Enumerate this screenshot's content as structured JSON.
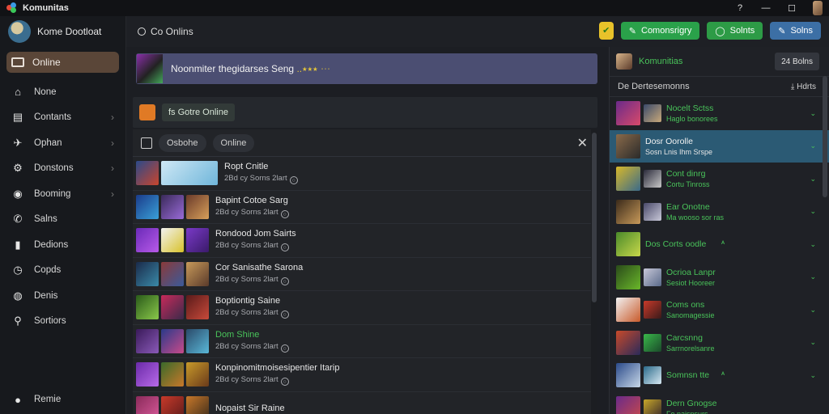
{
  "window": {
    "title": "Komunitas",
    "controls": [
      "?",
      "—",
      "☐",
      ""
    ]
  },
  "sidebar": {
    "profile_name": "Kome Dootloat",
    "active_item": "Online",
    "items": [
      {
        "label": "None",
        "icon": "home-icon",
        "glyph": "⌂",
        "chevron": false
      },
      {
        "label": "Contants",
        "icon": "book-icon",
        "glyph": "▤",
        "chevron": true
      },
      {
        "label": "Ophan",
        "icon": "compass-icon",
        "glyph": "✈",
        "chevron": true
      },
      {
        "label": "Donstons",
        "icon": "gear-icon",
        "glyph": "⚙",
        "chevron": true
      },
      {
        "label": "Booming",
        "icon": "globe-icon",
        "glyph": "◉",
        "chevron": true
      },
      {
        "label": "Salns",
        "icon": "phone-icon",
        "glyph": "✆",
        "chevron": false
      },
      {
        "label": "Dedions",
        "icon": "document-icon",
        "glyph": "▮",
        "chevron": false
      },
      {
        "label": "Copds",
        "icon": "clock-icon",
        "glyph": "◷",
        "chevron": false
      },
      {
        "label": "Denis",
        "icon": "disc-icon",
        "glyph": "◍",
        "chevron": false
      },
      {
        "label": "Sortiors",
        "icon": "search-icon",
        "glyph": "⚲",
        "chevron": false
      }
    ],
    "bottom_item": {
      "label": "Remie",
      "icon": "info-icon",
      "glyph": "●"
    }
  },
  "header": {
    "search_label": "Co Onlins",
    "buttons": [
      {
        "label": "Comonsrigry",
        "style": "green",
        "glyph": "✎"
      },
      {
        "label": "Solnts",
        "style": "green2",
        "glyph": "◯"
      },
      {
        "label": "Solns",
        "style": "blue",
        "glyph": "✎"
      }
    ]
  },
  "banner": {
    "text": "Noonmiter thegidarses Seng",
    "highlight": "..⭑⭑⭑ ⋯"
  },
  "online_chip": "fs Gotre Online",
  "list": {
    "tabs": [
      "Osbohe",
      "Online"
    ],
    "close_glyph": "✕",
    "rows": [
      {
        "title": "Ropt Cnitle",
        "sub": "2Bd cy Sorns 2lart",
        "green": false,
        "thumbs": [
          "#2b4a8a,#c8452d",
          "wide:#cfe8f5,#6fb6da",
          ""
        ]
      },
      {
        "title": "Bapint Cotoe Sarg",
        "sub": "2Bd cy Sorns 2lart",
        "green": false,
        "thumbs": [
          "#1a3b8a,#3aa0d8",
          "#3a2a5a,#9a6bd8",
          "#6a3a2a,#d8a05a"
        ]
      },
      {
        "title": "Rondood Jom Sairts",
        "sub": "2Bd cy Sorns 2lart",
        "green": false,
        "thumbs": [
          "#6a2ab8,#b85ae8",
          "#f2f2f2,#d8c22a",
          "#7a3ac8,#3a1a6a"
        ]
      },
      {
        "title": "Cor Sanisathe Sarona",
        "sub": "2Bd cy Sorns 2lart",
        "green": false,
        "thumbs": [
          "#1a2a4a,#3a8aa8",
          "#8a3a3a,#3a5a9a",
          "#c89a5a,#5a3a2a"
        ]
      },
      {
        "title": "Boptiontig Saine",
        "sub": "2Bd cy Sorns 2lart",
        "green": false,
        "thumbs": [
          "#2a5a1a,#8ac84a",
          "#c82a5a,#3a2a4a",
          "#5a1a1a,#c84a3a"
        ]
      },
      {
        "title": "Dom Shine",
        "sub": "2Bd cy Sorns 2lart",
        "green": true,
        "thumbs": [
          "#3a1a5a,#8a5ab8",
          "#2a3a8a,#c84a8a",
          "#2a4a6a,#5ab8d8"
        ]
      },
      {
        "title": "Konpinomitmoisesipentier Itarip",
        "sub": "2Bd cy Sorns 2lart",
        "green": false,
        "thumbs": [
          "#6a2aa8,#b86ae8",
          "#3a6a2a,#c8782a",
          "#c89a2a,#6a3a1a"
        ]
      },
      {
        "title": "Nopaist Sir Raine",
        "sub": "",
        "green": false,
        "thumbs": [
          "#8a2a5a,#d85a9a",
          "#c83a2a,#5a1a1a",
          "#c8782a,#3a2a1a"
        ]
      }
    ]
  },
  "right": {
    "title": "Komunitias",
    "button": "24 Bolns",
    "subheader": "De Dertesemonns",
    "subheader_right": "⤓ Hdrts",
    "friends": [
      {
        "name": "Nocelt Sctss",
        "status": "Haglo bonorees",
        "active": false,
        "caret": "⌄",
        "mark": "",
        "avatars": [
          "#6a2a8a,#d84a6a",
          "#3a4a6a,#c8a87a"
        ]
      },
      {
        "name": "Dosr Oorolle",
        "status": "Sosn Lnis Ihm Srspe",
        "active": true,
        "caret": "⌄",
        "mark": "",
        "avatars": [
          "#8a6a4a,#2a2a2a",
          ""
        ]
      },
      {
        "name": "Cont dinrg",
        "status": "Cortu Tinross",
        "active": false,
        "caret": "⌄",
        "mark": "",
        "avatars": [
          "#d8b82a,#3a6a8a",
          "#2a2a3a,#c8c8c8"
        ]
      },
      {
        "name": "Ear Onotne",
        "status": "Ma wooso sor ras",
        "active": false,
        "caret": "⌄",
        "mark": "",
        "avatars": [
          "#3a2a1a,#c89a5a",
          "#4a4a6a,#c8c8d8"
        ]
      },
      {
        "name": "Dos Corts oodle",
        "status": "",
        "active": false,
        "caret": "⌄",
        "mark": "ᴬ",
        "avatars": [
          "#4a8a2a,#c8d84a",
          ""
        ]
      },
      {
        "name": "Ocrioa Lanpr",
        "status": "Sesiot Hooreer",
        "active": false,
        "caret": "⌄",
        "mark": "",
        "avatars": [
          "#2a4a1a,#6ab82a",
          "#c8c8d8,#5a6a8a"
        ]
      },
      {
        "name": "Coms ons",
        "status": "Sanomagessie",
        "active": false,
        "caret": "⌄",
        "mark": "",
        "avatars": [
          "#f2f2f2,#c85a2a",
          "#c83a2a,#3a1a1a"
        ]
      },
      {
        "name": "Carcsnng",
        "status": "Sarrnorelsanre",
        "active": false,
        "caret": "⌄",
        "mark": "",
        "avatars": [
          "#c84a2a,#2a2a5a",
          "#3ab84a,#1a4a2a"
        ]
      },
      {
        "name": "Somnsn tte",
        "status": "",
        "active": false,
        "caret": "⌄",
        "mark": "ᴬ",
        "avatars": [
          "#2a4a8a,#c8d8e8",
          "#2a6a8a,#d8e8f2"
        ]
      },
      {
        "name": "Dern Gnogse",
        "status": "Fo naisnsurs",
        "active": false,
        "caret": "",
        "mark": "",
        "avatars": [
          "#6a2a8a,#c84a4a",
          "#c8a82a,#3a2a2a"
        ]
      }
    ]
  },
  "colors": {
    "accent_green": "#49c35a",
    "button_green": "#2aa14a",
    "button_blue": "#3c6fa5",
    "active_friend": "#2b5a74",
    "sidebar_active": "#5a4638",
    "banner": "#4b4e72"
  }
}
